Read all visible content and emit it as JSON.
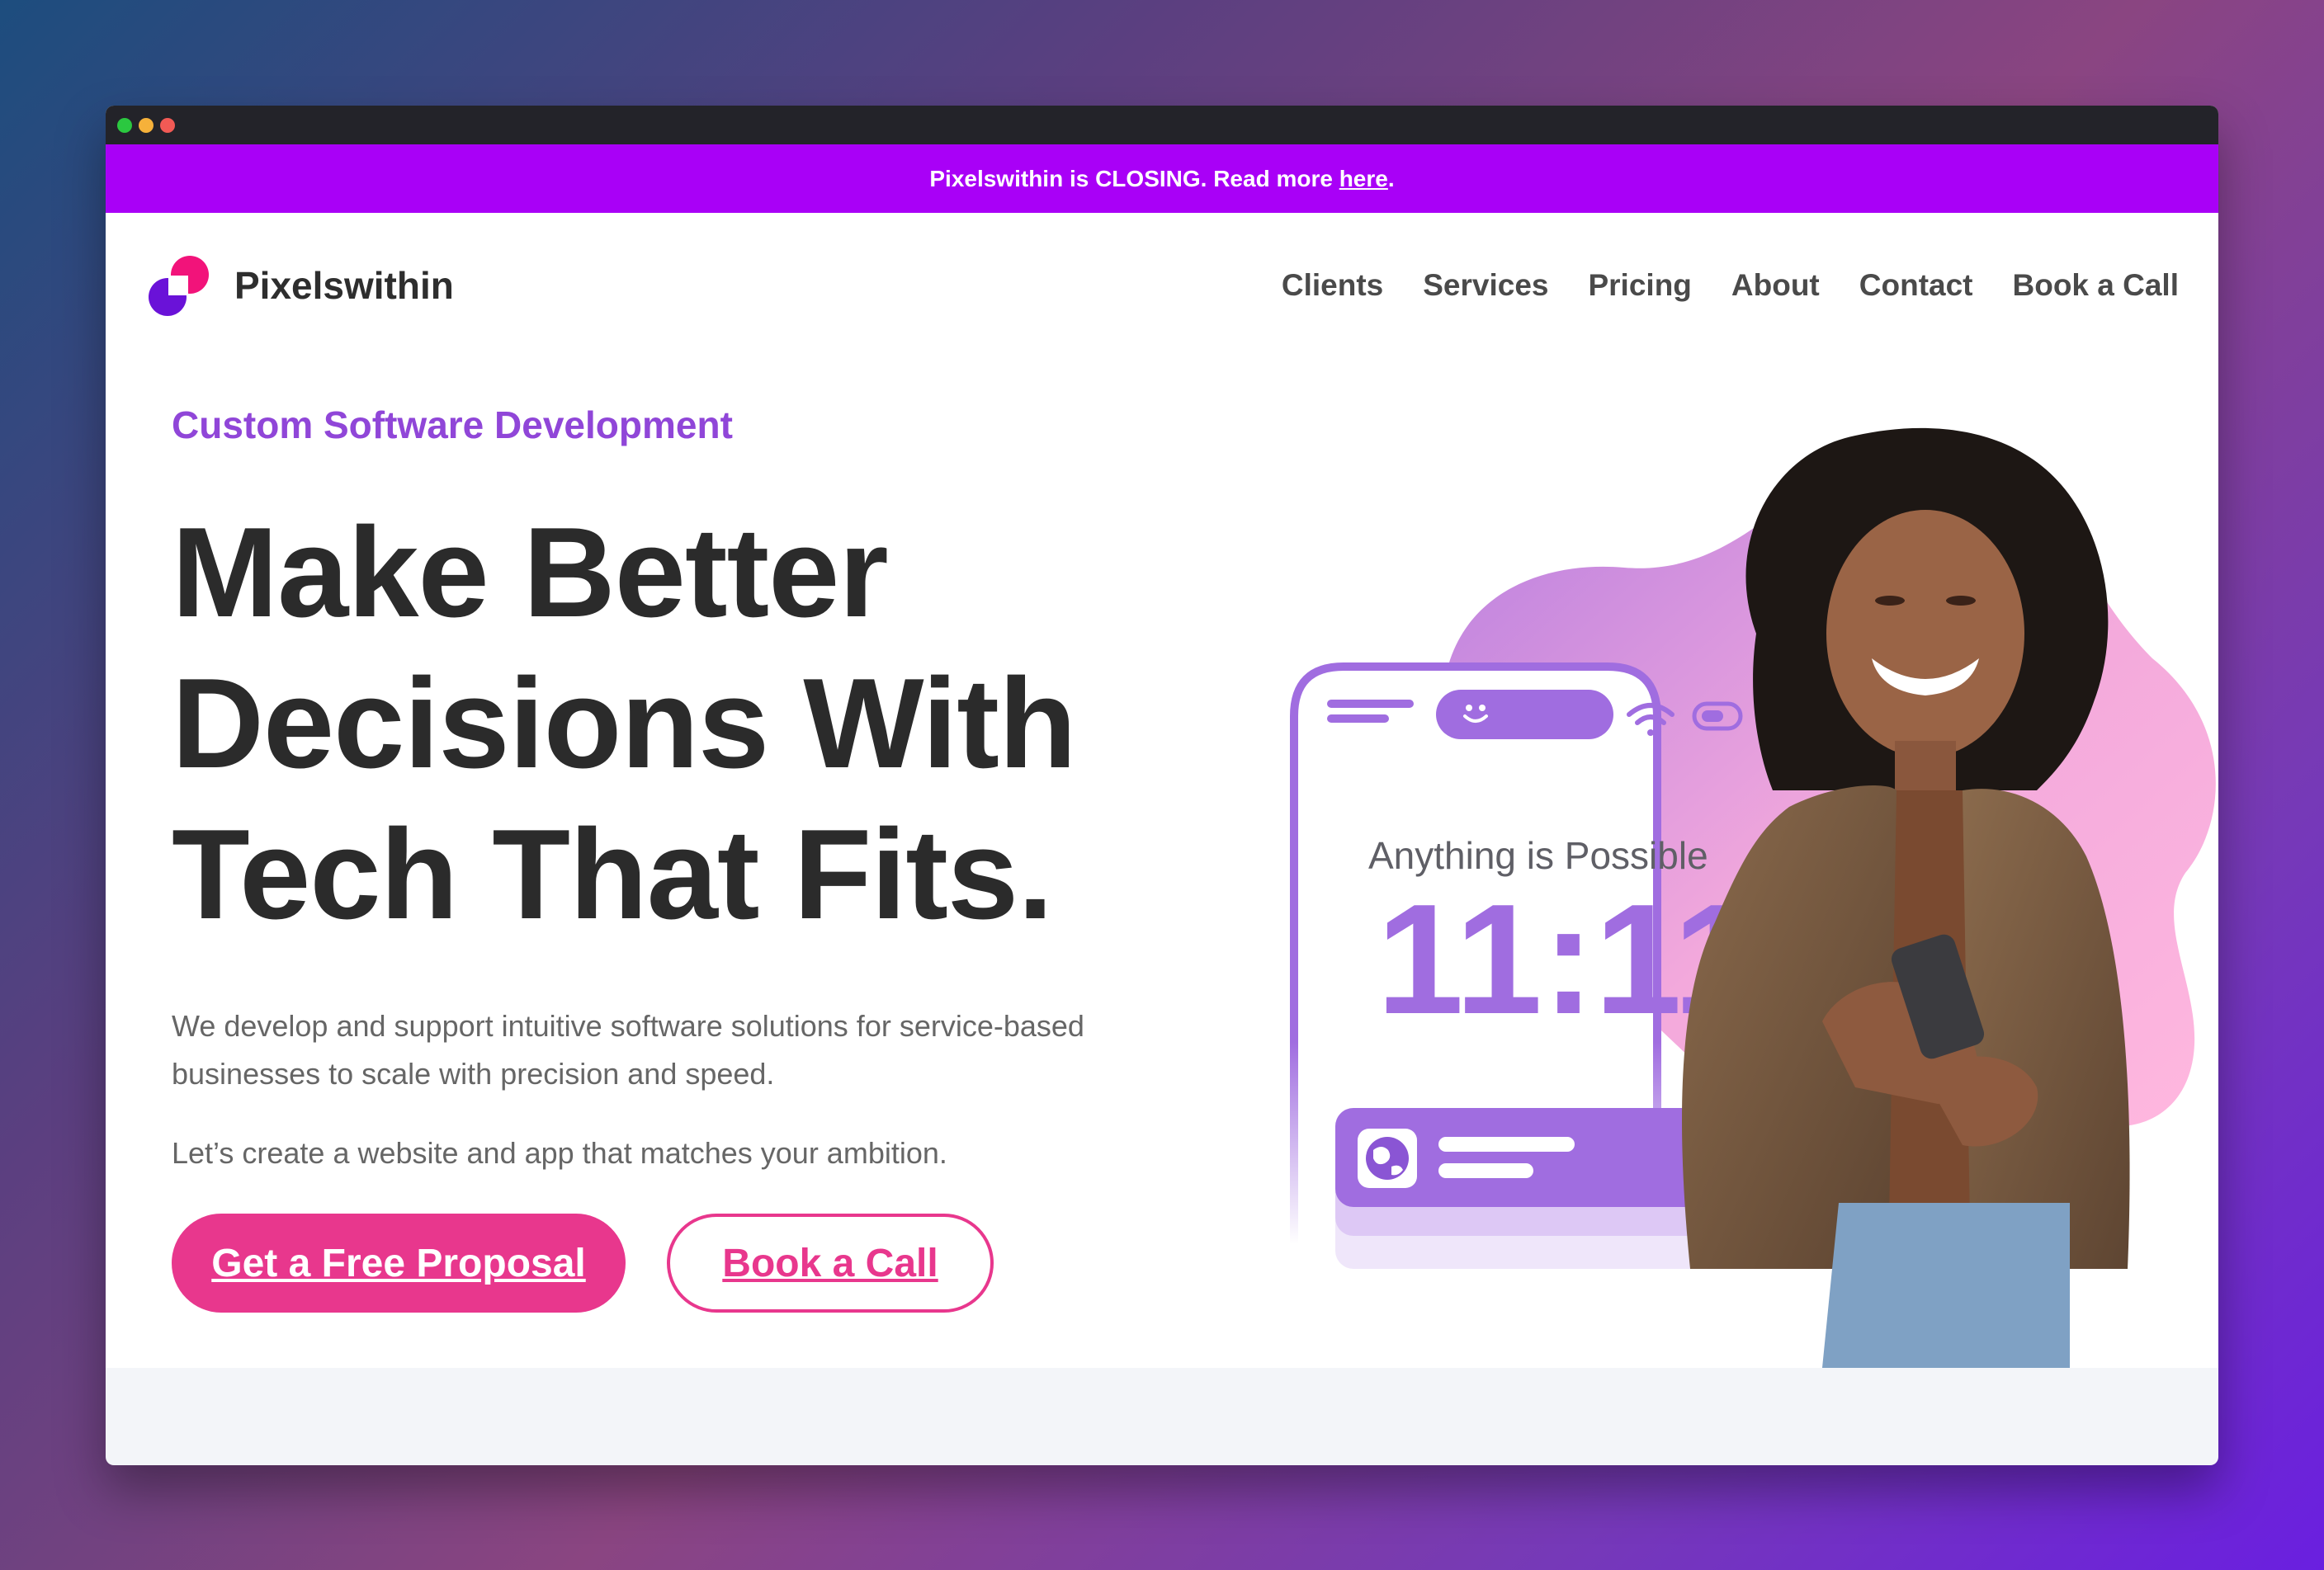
{
  "announcement": {
    "text_before": "Pixelswithin is CLOSING. Read more ",
    "link": "here",
    "text_after": "."
  },
  "brand": {
    "name": "Pixelswithin"
  },
  "nav": {
    "items": [
      {
        "label": "Clients"
      },
      {
        "label": "Services"
      },
      {
        "label": "Pricing"
      },
      {
        "label": "About"
      },
      {
        "label": "Contact"
      },
      {
        "label": "Book a Call"
      }
    ]
  },
  "hero": {
    "eyebrow": "Custom Software Development",
    "headline_line1": "Make Better",
    "headline_line2": "Decisions With",
    "headline_line3": "Tech That Fits.",
    "lead": "We develop and support intuitive software solutions for service-based businesses to scale with precision and speed.",
    "lead2": "Let’s create a website and app that matches your ambition.",
    "cta_primary": "Get a Free Proposal",
    "cta_secondary": "Book a Call"
  },
  "phone": {
    "caption": "Anything is Possible",
    "time": "11:11"
  },
  "colors": {
    "announcement_bg": "#a900f7",
    "accent_pink": "#e8378d",
    "accent_purple": "#9046d8",
    "phone_purple": "#a06de0"
  },
  "icons": [
    "smiley-icon",
    "wifi-icon",
    "battery-icon",
    "globe-icon"
  ]
}
